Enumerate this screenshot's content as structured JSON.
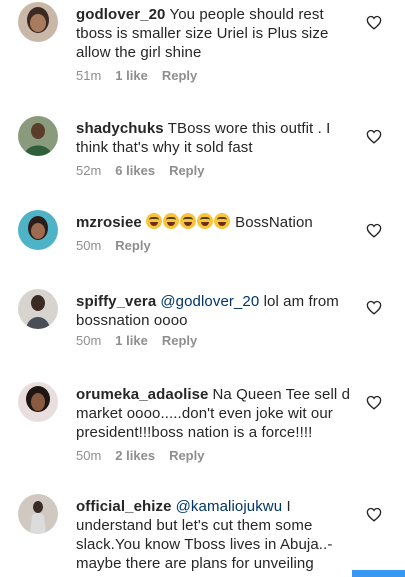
{
  "comments": [
    {
      "username": "godlover_20",
      "text": "You people should rest tboss is smaller size Uriel is Plus size allow the girl shine",
      "time": "51m",
      "likes": "1 like",
      "reply": "Reply",
      "avatar_icon": "user-avatar-icon"
    },
    {
      "username": "shadychuks",
      "text": "TBoss wore this outfit . I think that's why it sold fast",
      "time": "52m",
      "likes": "6 likes",
      "reply": "Reply",
      "avatar_icon": "user-avatar-icon"
    },
    {
      "username": "mzrosiee",
      "text": "BossNation",
      "emoji_count": 5,
      "emoji_icon": "grinning-squinting-face-emoji",
      "time": "50m",
      "likes": "",
      "reply": "Reply",
      "avatar_icon": "user-avatar-icon"
    },
    {
      "username": "spiffy_vera",
      "mention": "@godlover_20",
      "text": "lol am from bossnation oooo",
      "time": "50m",
      "likes": "1 like",
      "reply": "Reply",
      "avatar_icon": "user-avatar-icon"
    },
    {
      "username": "orumeka_adaolise",
      "text": "Na Queen Tee sell d market oooo.....don't even joke wit our president!!!boss nation is a force!!!!",
      "time": "50m",
      "likes": "2 likes",
      "reply": "Reply",
      "avatar_icon": "user-avatar-icon"
    },
    {
      "username": "official_ehize",
      "mention": "@kamaliojukwu",
      "text": "I understand but let's cut them some slack.You know Tboss lives in Abuja..- maybe there are plans for unveiling",
      "time": "",
      "likes": "",
      "reply": "",
      "avatar_icon": "user-avatar-icon"
    }
  ],
  "colors": {
    "text": "#262626",
    "meta": "#8e8e8e",
    "mention": "#003569",
    "accent_button": "#3897f0"
  },
  "icons": {
    "like": "heart-outline-icon"
  }
}
